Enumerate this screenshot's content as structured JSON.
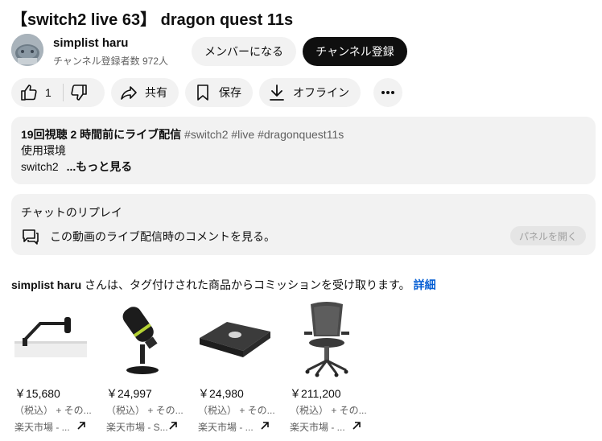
{
  "video": {
    "title": "【switch2 live 63】 dragon quest 11s"
  },
  "channel": {
    "name": "simplist haru",
    "subscribers": "チャンネル登録者数 972人",
    "member_label": "メンバーになる",
    "subscribe_label": "チャンネル登録"
  },
  "actions": {
    "like_count": "1",
    "share_label": "共有",
    "save_label": "保存",
    "offline_label": "オフライン",
    "more_icon": "more-horiz-icon"
  },
  "description": {
    "meta": "19回視聴  2 時間前にライブ配信",
    "tags": "#switch2 #live #dragonquest11s",
    "line1": "使用環境",
    "line2": "switch2",
    "more_label": "...もっと見る"
  },
  "chat_replay": {
    "title": "チャットのリプレイ",
    "text": "この動画のライブ配信時のコメントを見る。",
    "panel_label": "パネルを開く"
  },
  "commission": {
    "channel": "simplist haru",
    "text": " さんは、タグ付けされた商品からコミッションを受け取ります。",
    "detail_label": "詳細"
  },
  "products": [
    {
      "price": "￥15,680",
      "tax": "（税込） + その...",
      "store": "楽天市場 - ..."
    },
    {
      "price": "￥24,997",
      "tax": "（税込） + その...",
      "store": "楽天市場 - S..."
    },
    {
      "price": "￥24,980",
      "tax": "（税込） + その...",
      "store": "楽天市場 - ..."
    },
    {
      "price": "￥211,200",
      "tax": "（税込） + その...",
      "store": "楽天市場 - ..."
    }
  ],
  "colors": {
    "accent_link": "#065fd4",
    "pill_bg": "#f2f2f2",
    "subscribe_bg": "#0f0f0f"
  }
}
